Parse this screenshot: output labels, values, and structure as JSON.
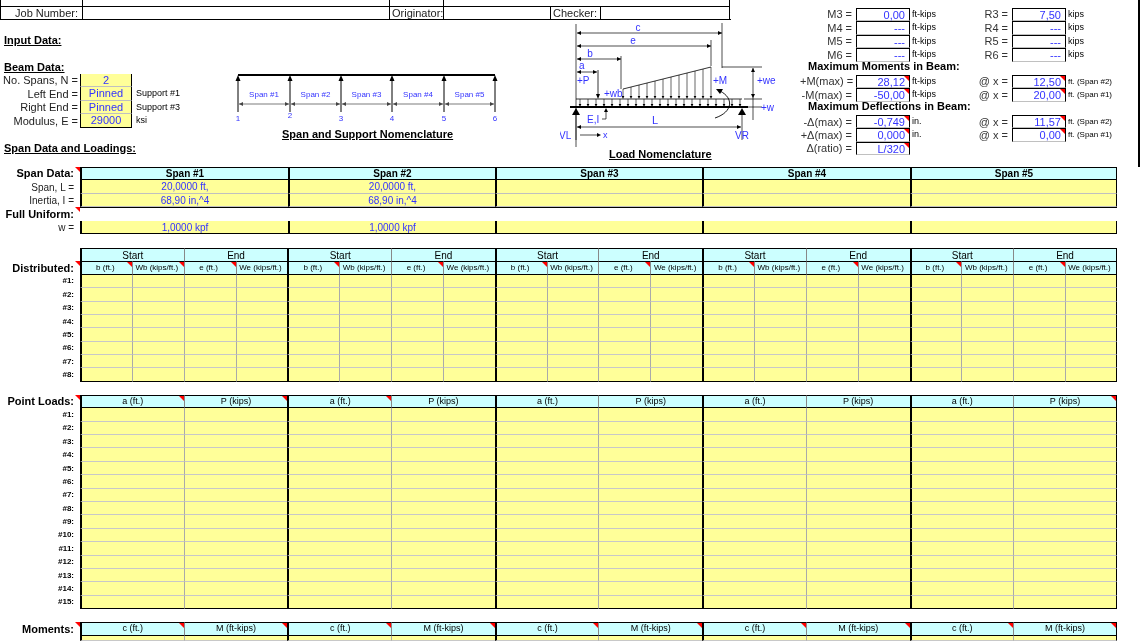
{
  "header": {
    "job_number_label": "Job Number:",
    "originator_label": "Originator:",
    "checker_label": "Checker:"
  },
  "input_title": "Input Data:",
  "beam_data": {
    "title": "Beam Data:",
    "fields": [
      {
        "label": "No. Spans, N =",
        "value": "2"
      },
      {
        "label": "Left End =",
        "value": "Pinned",
        "note": "Support #1"
      },
      {
        "label": "Right End =",
        "value": "Pinned",
        "note": "Support #3"
      },
      {
        "label": "Modulus, E =",
        "value": "29000",
        "note": "ksi"
      }
    ]
  },
  "span_section_title": "Span Data and Loadings:",
  "span_diagram": {
    "spans": [
      "Span #1",
      "Span #2",
      "Span #3",
      "Span #4",
      "Span #5"
    ],
    "supports": [
      "1",
      "2",
      "3",
      "4",
      "5",
      "6"
    ],
    "caption": "Span and Support Nomenclature"
  },
  "load_diagram": {
    "labels": {
      "c": "c",
      "e": "e",
      "b": "b",
      "a": "a",
      "point_load": "+P",
      "start_load": "+wb",
      "moment": "+M",
      "end_load": "+we",
      "uniform_load": "+w",
      "stiffness": "E,I",
      "length": "L",
      "left_reaction": "VL",
      "x_axis": "x",
      "right_reaction": "VR"
    },
    "caption": "Load Nomenclature"
  },
  "results": {
    "support_rows": [
      {
        "m_label": "M3 =",
        "m_value": "0,00",
        "m_unit": "ft-kips",
        "r_label": "R3 =",
        "r_value": "7,50",
        "r_unit": "kips"
      },
      {
        "m_label": "M4 =",
        "m_value": "---",
        "m_unit": "ft-kips",
        "r_label": "R4 =",
        "r_value": "---",
        "r_unit": "kips"
      },
      {
        "m_label": "M5 =",
        "m_value": "---",
        "m_unit": "ft-kips",
        "r_label": "R5 =",
        "r_value": "---",
        "r_unit": "kips"
      },
      {
        "m_label": "M6 =",
        "m_value": "---",
        "m_unit": "ft-kips",
        "r_label": "R6 =",
        "r_value": "---",
        "r_unit": "kips"
      }
    ],
    "sections": [
      {
        "title": "Maximum Moments in Beam:",
        "rows": [
          {
            "label": "+M(max) =",
            "value": "28,12",
            "comment": true,
            "unit": "ft-kips",
            "at_label": "@ x =",
            "at_value": "12,50",
            "at_comment": true,
            "at_note": "ft. (Span #2)"
          },
          {
            "label": "-M(max) =",
            "value": "-50,00",
            "comment": true,
            "unit": "ft-kips",
            "at_label": "@ x =",
            "at_value": "20,00",
            "at_comment": true,
            "at_note": "ft. (Span #1)"
          }
        ]
      },
      {
        "title": "Maximum Deflections in Beam:",
        "rows": [
          {
            "label": "-Δ(max) =",
            "value": "-0,749",
            "comment": true,
            "unit": "in.",
            "at_label": "@ x =",
            "at_value": "11,57",
            "at_comment": true,
            "at_note": "ft. (Span #2)"
          },
          {
            "label": "+Δ(max) =",
            "value": "0,000",
            "comment": true,
            "unit": "in.",
            "at_label": "@ x =",
            "at_value": "0,00",
            "at_comment": true,
            "at_note": "ft. (Span #1)"
          },
          {
            "label": "Δ(ratio) =",
            "value": "L/320",
            "comment": true
          }
        ]
      }
    ]
  },
  "span_data": {
    "label": "Span Data:",
    "comment": true,
    "spans": [
      "Span #1",
      "Span #2",
      "Span #3",
      "Span #4",
      "Span #5"
    ],
    "rows": [
      {
        "label": "Span, L =",
        "values": [
          "20,0000 ft,",
          "20,0000 ft,"
        ]
      },
      {
        "label": "Inertia, I =",
        "values": [
          "68,90 in,^4",
          "68,90 in,^4"
        ]
      }
    ],
    "uniform_label": "Full Uniform:",
    "uniform_comment": true,
    "uniform_row": {
      "label": "w =",
      "values": [
        "1,0000 kpf",
        "1,0000 kpf"
      ]
    }
  },
  "distributed": {
    "label": "Distributed:",
    "comment": true,
    "groups": [
      "Start",
      "End",
      "Start",
      "End",
      "Start",
      "End",
      "Start",
      "End",
      "Start",
      "End"
    ],
    "columns": [
      {
        "label": "b (ft.)",
        "comment": true
      },
      {
        "label": "Wb (kips/ft.)",
        "comment": true
      },
      {
        "label": "e (ft.)",
        "comment": true
      },
      {
        "label": "We (kips/ft.)",
        "comment": false
      },
      {
        "label": "b (ft.)",
        "comment": true
      },
      {
        "label": "Wb (kips/ft.)",
        "comment": false
      },
      {
        "label": "e (ft.)",
        "comment": true
      },
      {
        "label": "We (kips/ft.)",
        "comment": false
      },
      {
        "label": "b (ft.)",
        "comment": true
      },
      {
        "label": "Wb (kips/ft.)",
        "comment": false
      },
      {
        "label": "e (ft.)",
        "comment": true
      },
      {
        "label": "We (kips/ft.)",
        "comment": false
      },
      {
        "label": "b (ft.)",
        "comment": true
      },
      {
        "label": "Wb (kips/ft.)",
        "comment": false
      },
      {
        "label": "e (ft.)",
        "comment": true
      },
      {
        "label": "We (kips/ft.)",
        "comment": false
      },
      {
        "label": "b (ft.)",
        "comment": true
      },
      {
        "label": "Wb (kips/ft.)",
        "comment": false
      },
      {
        "label": "e (ft.)",
        "comment": true
      },
      {
        "label": "We (kips/ft.)",
        "comment": false
      }
    ],
    "rows": [
      "#1:",
      "#2:",
      "#3:",
      "#4:",
      "#5:",
      "#6:",
      "#7:",
      "#8:"
    ]
  },
  "point_loads": {
    "label": "Point Loads:",
    "comment": true,
    "columns": [
      {
        "label": "a (ft.)",
        "comment": true
      },
      {
        "label": "P (kips)",
        "comment": true
      },
      {
        "label": "a (ft.)",
        "comment": true
      },
      {
        "label": "P (kips)",
        "comment": false
      },
      {
        "label": "a (ft.)",
        "comment": false
      },
      {
        "label": "P (kips)",
        "comment": false
      },
      {
        "label": "a (ft.)",
        "comment": false
      },
      {
        "label": "P (kips)",
        "comment": false
      },
      {
        "label": "a (ft.)",
        "comment": false
      },
      {
        "label": "P (kips)",
        "comment": true
      }
    ],
    "rows": [
      "#1:",
      "#2:",
      "#3:",
      "#4:",
      "#5:",
      "#6:",
      "#7:",
      "#8:",
      "#9:",
      "#10:",
      "#11:",
      "#12:",
      "#13:",
      "#14:",
      "#15:"
    ]
  },
  "moments": {
    "label": "Moments:",
    "comment": true,
    "columns": [
      {
        "label": "c (ft.)",
        "comment": true
      },
      {
        "label": "M (ft-kips)",
        "comment": true
      },
      {
        "label": "c (ft.)",
        "comment": true
      },
      {
        "label": "M (ft-kips)",
        "comment": true
      },
      {
        "label": "c (ft.)",
        "comment": true
      },
      {
        "label": "M (ft-kips)",
        "comment": true
      },
      {
        "label": "c (ft.)",
        "comment": true
      },
      {
        "label": "M (ft-kips)",
        "comment": true
      },
      {
        "label": "c (ft.)",
        "comment": true
      },
      {
        "label": "M (ft-kips)",
        "comment": true
      }
    ]
  }
}
